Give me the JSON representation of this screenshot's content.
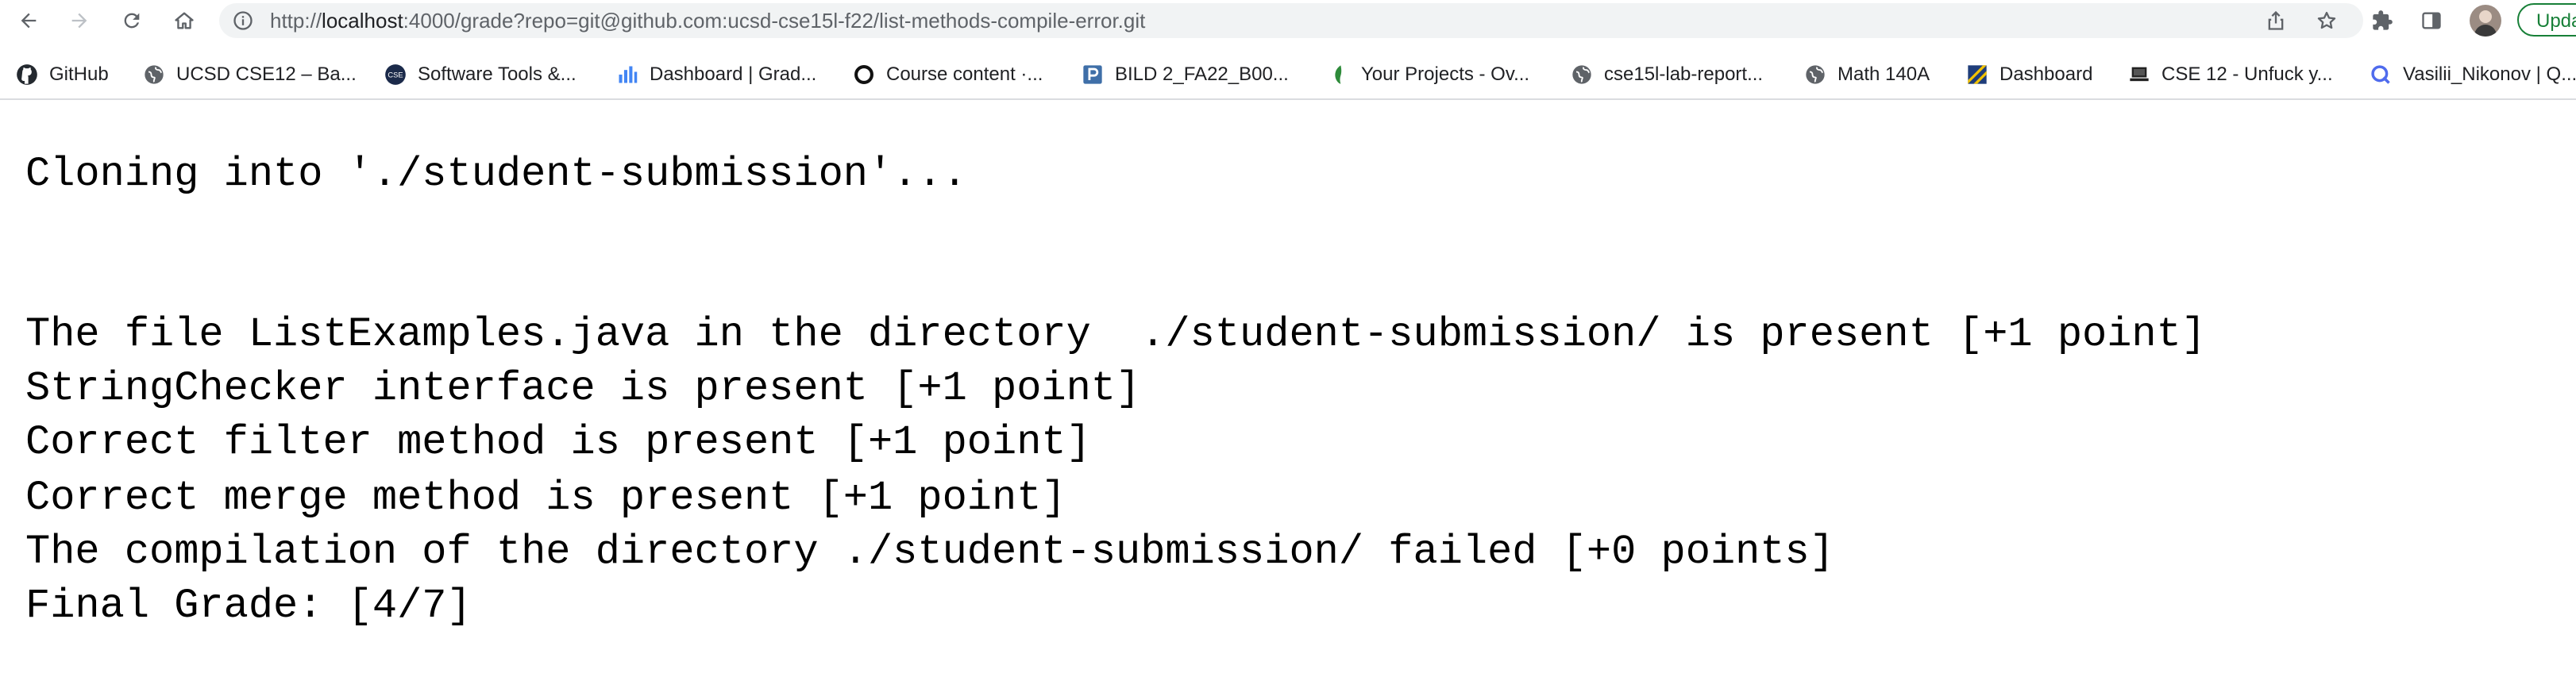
{
  "browser": {
    "url_scheme": "http://",
    "url_host": "localhost",
    "url_rest": ":4000/grade?repo=git@github.com:ucsd-cse15l-f22/list-methods-compile-error.git",
    "update_label": "Update",
    "icons": {
      "back": "arrow-left-icon",
      "forward": "arrow-right-icon",
      "reload": "reload-icon",
      "home": "home-icon",
      "site_info": "info-icon",
      "share": "share-icon",
      "bookmark": "star-icon",
      "extensions": "puzzle-icon",
      "side_panel": "side-panel-icon",
      "profile": "avatar"
    }
  },
  "bookmarks": [
    {
      "label": "GitHub",
      "icon": "github-icon"
    },
    {
      "label": "UCSD CSE12 – Ba...",
      "icon": "globe-icon"
    },
    {
      "label": "Software Tools &...",
      "icon": "cse-logo-icon"
    },
    {
      "label": "Dashboard | Grad...",
      "icon": "bar-chart-icon"
    },
    {
      "label": "Course content ·...",
      "icon": "circle-logo-icon"
    },
    {
      "label": "BILD 2_FA22_B00...",
      "icon": "p-logo-icon"
    },
    {
      "label": "Your Projects - Ov...",
      "icon": "leaf-icon"
    },
    {
      "label": "cse15l-lab-report...",
      "icon": "globe-icon"
    },
    {
      "label": "Math 140A",
      "icon": "globe-icon"
    },
    {
      "label": "Dashboard",
      "icon": "stripes-logo-icon"
    },
    {
      "label": "CSE 12 - Unfuck y...",
      "icon": "laptop-icon"
    },
    {
      "label": "Vasilii_Nikonov | Q...",
      "icon": "q-logo-icon"
    }
  ],
  "output": {
    "line1": "Cloning into './student-submission'...",
    "line2": "The file ListExamples.java in the directory  ./student-submission/ is present [+1 point]",
    "line3": "StringChecker interface is present [+1 point]",
    "line4": "Correct filter method is present [+1 point]",
    "line5": "Correct merge method is present [+1 point]",
    "line6": "The compilation of the directory ./student-submission/ failed [+0 points]",
    "line7": "Final Grade: [4/7]"
  }
}
